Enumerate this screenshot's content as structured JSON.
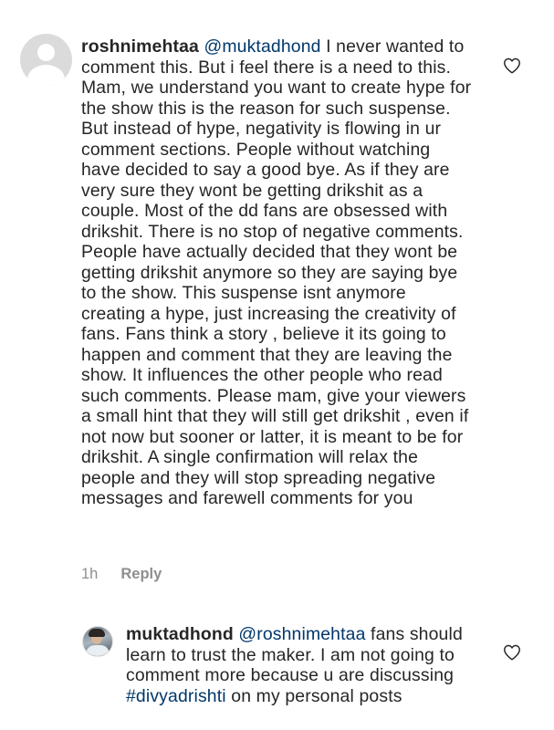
{
  "comments": [
    {
      "username": "roshnimehtaa",
      "mention": "@muktadhond",
      "text": " I never wanted to comment this. But i feel there is a need to this. Mam, we understand you want to create hype for the show this is the reason for such suspense. But instead of hype, negativity is flowing in ur comment sections. People without watching have decided to say a good bye. As if they are very sure they wont be getting drikshit as a couple. Most of the dd fans are obsessed with drikshit. There is no stop of negative comments. People have actually decided that they wont be getting drikshit anymore so they are saying bye to the show. This suspense isnt anymore creating a hype, just increasing the creativity of fans. Fans think a story , believe it its going to happen and comment that they are leaving the show. It influences the other people who read such comments. Please mam, give your viewers a small hint that they will still get drikshit , even if not now but sooner or latter, it is meant to be for drikshit. A single confirmation will relax the people and they will stop spreading negative messages and farewell comments for you",
      "time": "1h",
      "reply_label": "Reply",
      "avatar_icon": "default-avatar-icon",
      "like_icon": "heart-outline-icon"
    },
    {
      "username": "muktadhond",
      "mention": "@roshnimehtaa",
      "text_before": " fans should learn to trust the maker. I am not going to comment more because u are discussing ",
      "hashtag": "#divyadrishti",
      "text_after": " on my personal posts",
      "avatar_icon": "profile-photo",
      "like_icon": "heart-outline-icon"
    }
  ],
  "colors": {
    "text": "#262626",
    "link": "#00376b",
    "muted": "#8e8e8e",
    "avatar_placeholder": "#dbdbdb"
  }
}
